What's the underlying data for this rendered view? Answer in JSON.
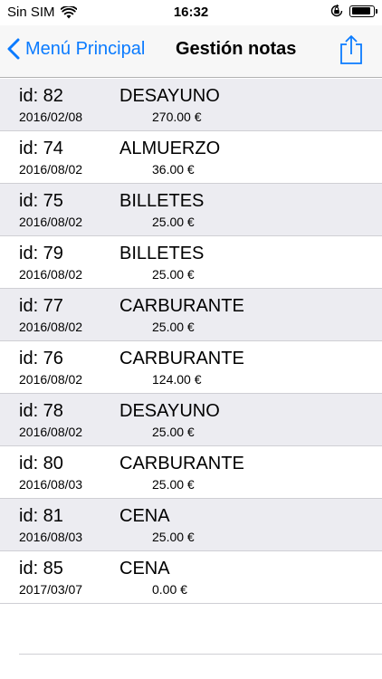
{
  "status": {
    "carrier": "Sin SIM",
    "time": "16:32"
  },
  "nav": {
    "back_label": "Menú Principal",
    "title": "Gestión notas",
    "accent_color": "#0a7bff"
  },
  "notes": [
    {
      "id": "id: 82",
      "date": "2016/02/08",
      "concept": "DESAYUNO",
      "amount": "270.00 €"
    },
    {
      "id": "id: 74",
      "date": "2016/08/02",
      "concept": "ALMUERZO",
      "amount": "36.00 €"
    },
    {
      "id": "id: 75",
      "date": "2016/08/02",
      "concept": "BILLETES",
      "amount": "25.00 €"
    },
    {
      "id": "id: 79",
      "date": "2016/08/02",
      "concept": "BILLETES",
      "amount": "25.00 €"
    },
    {
      "id": "id: 77",
      "date": "2016/08/02",
      "concept": "CARBURANTE",
      "amount": "25.00 €"
    },
    {
      "id": "id: 76",
      "date": "2016/08/02",
      "concept": "CARBURANTE",
      "amount": "124.00 €"
    },
    {
      "id": "id: 78",
      "date": "2016/08/02",
      "concept": "DESAYUNO",
      "amount": "25.00 €"
    },
    {
      "id": "id: 80",
      "date": "2016/08/03",
      "concept": "CARBURANTE",
      "amount": "25.00 €"
    },
    {
      "id": "id: 81",
      "date": "2016/08/03",
      "concept": "CENA",
      "amount": "25.00 €"
    },
    {
      "id": "id: 85",
      "date": "2017/03/07",
      "concept": "CENA",
      "amount": "0.00 €"
    }
  ],
  "icons": {
    "wifi": "wifi-icon",
    "orientation_lock": "orientation-lock-icon",
    "battery": "battery-icon",
    "back": "chevron-left-icon",
    "share": "share-icon"
  },
  "battery_level": 0.9
}
